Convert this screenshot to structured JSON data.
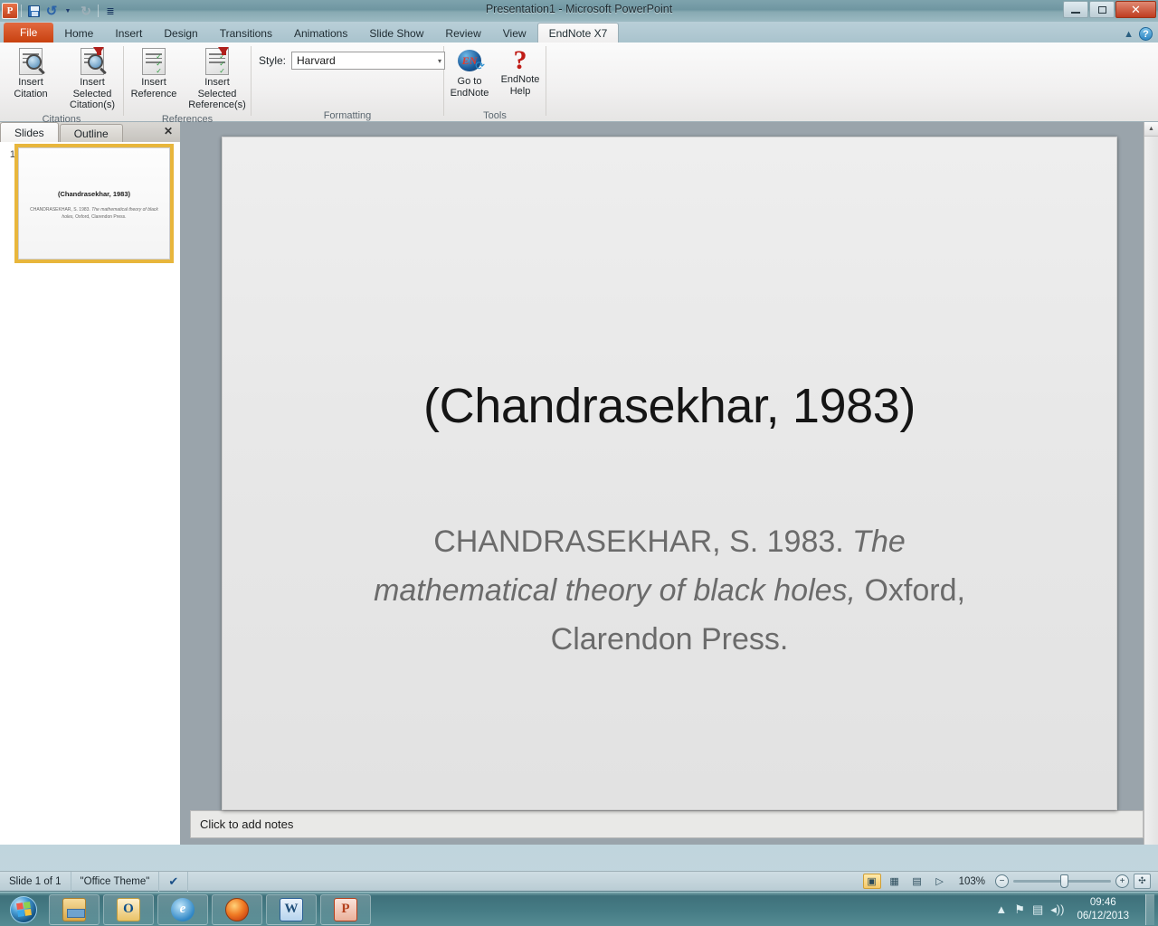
{
  "window": {
    "title": "Presentation1  -  Microsoft PowerPoint",
    "quick_access": [
      {
        "name": "powerpoint-logo",
        "label": "P"
      },
      {
        "name": "save-icon",
        "label": ""
      },
      {
        "name": "undo-icon",
        "label": "↶"
      },
      {
        "name": "undo-dropdown-icon",
        "label": "▾"
      },
      {
        "name": "redo-icon",
        "label": "↷"
      },
      {
        "name": "customize-quick-access-icon",
        "label": "☰"
      }
    ],
    "controls": {
      "minimize": "—",
      "restore": "❐",
      "close": "✕"
    }
  },
  "tabs": [
    {
      "label": "File",
      "type": "file"
    },
    {
      "label": "Home",
      "type": "normal"
    },
    {
      "label": "Insert",
      "type": "normal"
    },
    {
      "label": "Design",
      "type": "normal"
    },
    {
      "label": "Transitions",
      "type": "normal"
    },
    {
      "label": "Animations",
      "type": "normal"
    },
    {
      "label": "Slide Show",
      "type": "normal"
    },
    {
      "label": "Review",
      "type": "normal"
    },
    {
      "label": "View",
      "type": "normal"
    },
    {
      "label": "EndNote X7",
      "type": "active"
    }
  ],
  "tabstrip_right": {
    "collapse_ribbon_icon": "▲",
    "help_icon": "?"
  },
  "ribbon": {
    "groups": [
      {
        "name": "citations",
        "label": "Citations",
        "buttons": [
          {
            "name": "insert-citation-button",
            "line1": "Insert",
            "line2": "Citation",
            "icon": "insert-citation-icon"
          },
          {
            "name": "insert-selected-citations-button",
            "line1": "Insert Selected",
            "line2": "Citation(s)",
            "icon": "insert-selected-citations-icon"
          }
        ]
      },
      {
        "name": "references",
        "label": "References",
        "buttons": [
          {
            "name": "insert-reference-button",
            "line1": "Insert",
            "line2": "Reference",
            "icon": "insert-reference-icon"
          },
          {
            "name": "insert-selected-references-button",
            "line1": "Insert Selected",
            "line2": "Reference(s)",
            "icon": "insert-selected-references-icon"
          }
        ]
      },
      {
        "name": "formatting",
        "label": "Formatting",
        "style_label": "Style:",
        "style_value": "Harvard",
        "style_arrow": "▾"
      },
      {
        "name": "tools",
        "label": "Tools",
        "buttons": [
          {
            "name": "go-to-endnote-button",
            "line1": "Go to",
            "line2": "EndNote",
            "icon": "endnote-logo-icon"
          },
          {
            "name": "endnote-help-button",
            "line1": "EndNote",
            "line2": "Help",
            "icon": "question-mark-icon"
          }
        ]
      }
    ]
  },
  "slide_panel": {
    "tabs": [
      {
        "label": "Slides",
        "active": true
      },
      {
        "label": "Outline",
        "active": false
      }
    ],
    "close_label": "✕",
    "thumbnails": [
      {
        "number": "1",
        "title": "(Chandrasekhar, 1983)",
        "body_plain_1": "CHANDRASEKHAR, S. 1983. ",
        "body_italic": "The mathematical theory of black holes,",
        "body_plain_2": " Oxford, Clarendon Press."
      }
    ]
  },
  "slide": {
    "title": "(Chandrasekhar, 1983)",
    "body_plain_1": "CHANDRASEKHAR, S. 1983. ",
    "body_italic": "The mathematical theory of black holes,",
    "body_plain_2": " Oxford, Clarendon Press."
  },
  "notes": {
    "placeholder": "Click to add notes"
  },
  "status_bar": {
    "slide_counter": "Slide 1 of 1",
    "theme": "\"Office Theme\"",
    "spellcheck_icon": "✔",
    "view_buttons": [
      {
        "name": "normal-view-button",
        "glyph": "▣",
        "active": true
      },
      {
        "name": "slide-sorter-button",
        "glyph": "▦",
        "active": false
      },
      {
        "name": "reading-view-button",
        "glyph": "▤",
        "active": false
      },
      {
        "name": "slide-show-button",
        "glyph": "▷",
        "active": false
      }
    ],
    "zoom_level": "103%",
    "zoom_out": "−",
    "zoom_in": "+",
    "fit_to_window": "✣"
  },
  "taskbar": {
    "start_label": "Start",
    "items": [
      {
        "name": "taskbar-windows-explorer",
        "label": ""
      },
      {
        "name": "taskbar-outlook",
        "label": "O"
      },
      {
        "name": "taskbar-internet-explorer",
        "label": "e"
      },
      {
        "name": "taskbar-firefox",
        "label": ""
      },
      {
        "name": "taskbar-word",
        "label": "W"
      },
      {
        "name": "taskbar-powerpoint",
        "label": "P"
      }
    ],
    "tray": {
      "show_hidden_icon": "▲",
      "action_center_icon": "⚑",
      "network_icon": "▤",
      "volume_icon": "◂))",
      "time": "09:46",
      "date": "06/12/2013"
    }
  },
  "colors": {
    "file_tab": "#c8410f",
    "taskbar": "#4a8088",
    "thumb_highlight": "#e8b63c",
    "slide_bg": "#e8e8e8",
    "body_text": "#6b6b6b"
  }
}
